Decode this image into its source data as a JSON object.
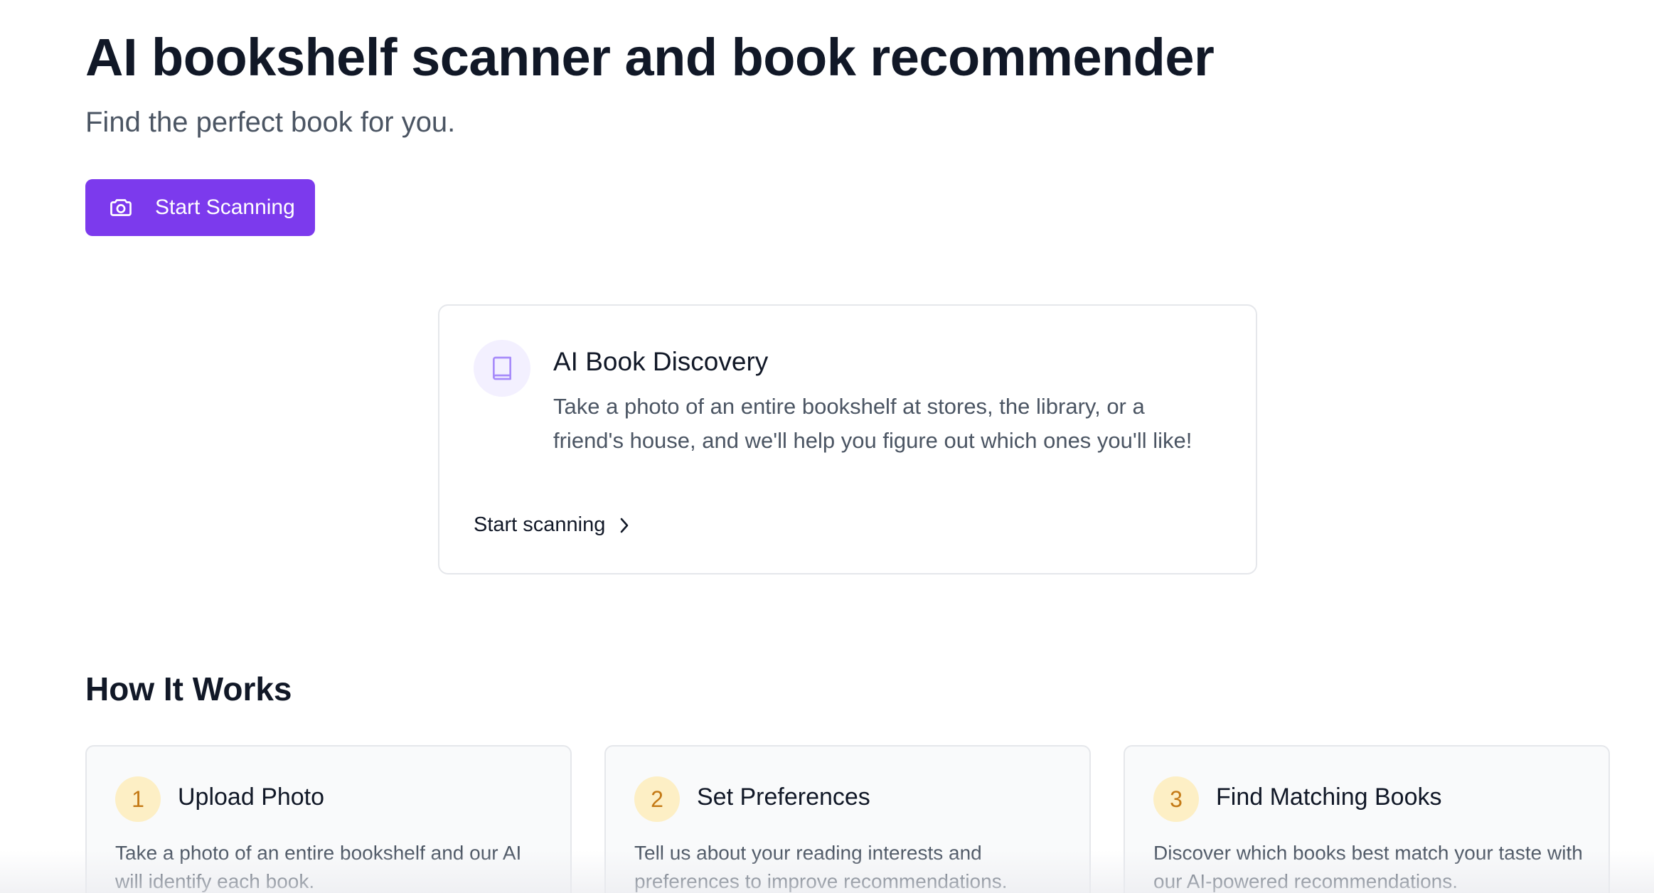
{
  "hero": {
    "title": "AI bookshelf scanner and book recommender",
    "subtitle": "Find the perfect book for you.",
    "cta_label": "Start Scanning",
    "cta_icon": "camera-icon"
  },
  "feature": {
    "icon": "book-icon",
    "title": "AI Book Discovery",
    "description": "Take a photo of an entire bookshelf at stores, the library, or a friend's house, and we'll help you figure out which ones you'll like!",
    "link_label": "Start scanning",
    "link_icon": "chevron-right-icon"
  },
  "how_it_works": {
    "title": "How It Works",
    "steps": [
      {
        "number": "1",
        "title": "Upload Photo",
        "description": "Take a photo of an entire bookshelf and our AI will identify each book."
      },
      {
        "number": "2",
        "title": "Set Preferences",
        "description": "Tell us about your reading interests and preferences to improve recommendations."
      },
      {
        "number": "3",
        "title": "Find Matching Books",
        "description": "Discover which books best match your taste with our AI-powered recommendations."
      }
    ]
  },
  "colors": {
    "accent": "#7c3aed",
    "step_badge_bg": "#fdefc5",
    "step_badge_text": "#c47a16",
    "feature_icon_bg": "#f3f0ff"
  }
}
